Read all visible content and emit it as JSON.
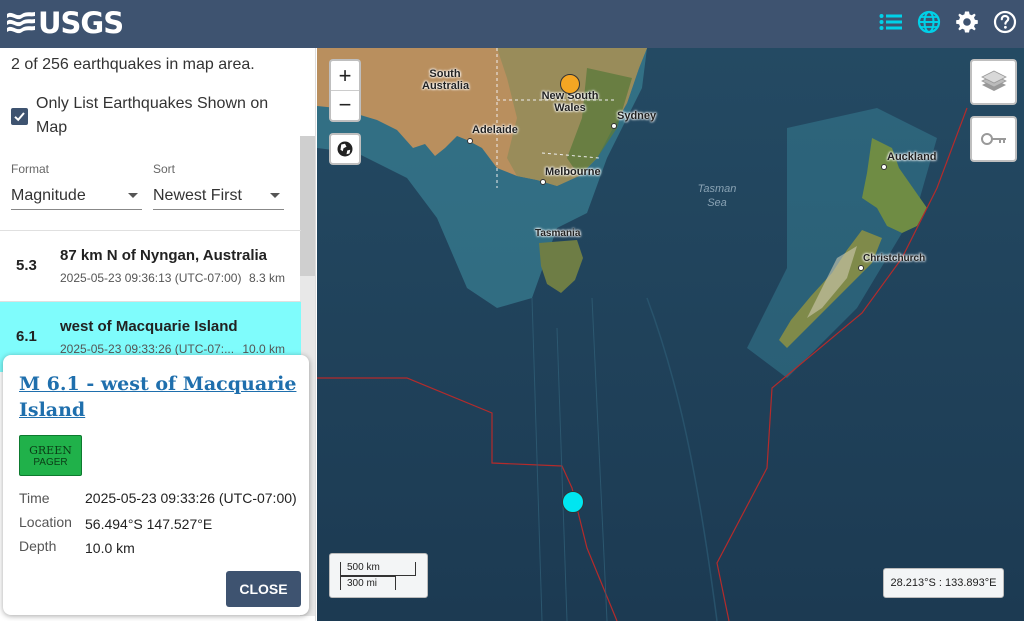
{
  "header": {
    "logo_text": "USGS",
    "icons": [
      "list-icon",
      "globe-icon",
      "gear-icon",
      "help-icon"
    ],
    "colors": {
      "bar": "#3e5370",
      "active_icon": "#00d1e8"
    }
  },
  "sidebar": {
    "count_text": "2 of 256 earthquakes in map area.",
    "only_list_label": "Only List Earthquakes Shown on Map",
    "only_list_checked": true,
    "format": {
      "label": "Format",
      "value": "Magnitude"
    },
    "sort": {
      "label": "Sort",
      "value": "Newest First"
    },
    "earthquakes": [
      {
        "mag": "5.3",
        "place": "87 km N of Nyngan, Australia",
        "time": "2025-05-23 09:36:13 (UTC-07:00)",
        "depth": "8.3 km",
        "selected": false
      },
      {
        "mag": "6.1",
        "place": "west of Macquarie Island",
        "time": "2025-05-23 09:33:26 (UTC-07:...",
        "depth": "10.0 km",
        "selected": true
      }
    ]
  },
  "popup": {
    "title": "M 6.1 - west of Macquarie Island",
    "pager_line1": "GREEN",
    "pager_line2": "PAGER",
    "pager_color": "#20b14a",
    "rows": [
      {
        "label": "Time",
        "value": "2025-05-23 09:33:26 (UTC-07:00)"
      },
      {
        "label": "Location",
        "value": "56.494°S 147.527°E"
      },
      {
        "label": "Depth",
        "value": "10.0 km"
      }
    ],
    "close_label": "CLOSE"
  },
  "map": {
    "zoom_in": "+",
    "zoom_out": "−",
    "labels": {
      "south_australia": "South Australia",
      "new_south_wales": "New South Wales",
      "sydney": "Sydney",
      "adelaide": "Adelaide",
      "melbourne": "Melbourne",
      "tasmania": "Tasmania",
      "tasman_sea": "Tasman Sea",
      "auckland": "Auckland",
      "christchurch": "Christchurch"
    },
    "scale": {
      "km": "500 km",
      "mi": "300 mi"
    },
    "coordinates": "28.213°S : 133.893°E",
    "quake_colors": {
      "orange": "#f5a623",
      "cyan": "#00e6f0"
    }
  }
}
